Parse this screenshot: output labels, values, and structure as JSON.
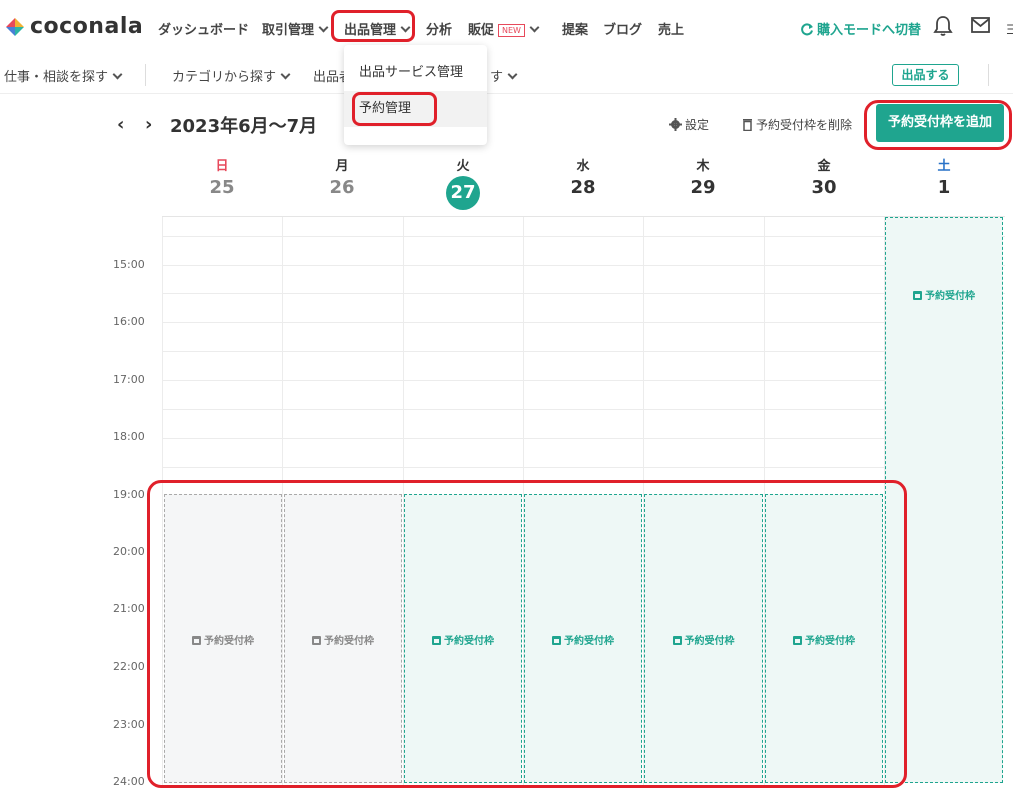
{
  "header": {
    "logo_text": "coconala",
    "nav": [
      {
        "label": "ダッシュボード"
      },
      {
        "label": "取引管理"
      },
      {
        "label": "出品管理"
      },
      {
        "label": "分析"
      },
      {
        "label": "販促",
        "badge": "NEW"
      },
      {
        "label": "提案"
      },
      {
        "label": "ブログ"
      },
      {
        "label": "売上"
      }
    ],
    "mode_switch": "購入モードへ切替",
    "more": "ヨ"
  },
  "subnav": {
    "items": [
      "仕事・相談を探す",
      "カテゴリから探す",
      "出品者",
      "す"
    ],
    "post_button": "出品する"
  },
  "dropdown": {
    "items": [
      "出品サービス管理",
      "予約管理"
    ]
  },
  "calendar": {
    "title": "2023年6月〜7月",
    "prev": "‹",
    "next": "›",
    "settings": "設定",
    "delete_slots": "予約受付枠を削除",
    "add_slot": "予約受付枠を追加",
    "days": [
      {
        "dow": "日",
        "num": "25"
      },
      {
        "dow": "月",
        "num": "26"
      },
      {
        "dow": "火",
        "num": "27"
      },
      {
        "dow": "水",
        "num": "28"
      },
      {
        "dow": "木",
        "num": "29"
      },
      {
        "dow": "金",
        "num": "30"
      },
      {
        "dow": "土",
        "num": "1"
      }
    ],
    "times": [
      "15:00",
      "16:00",
      "17:00",
      "18:00",
      "19:00",
      "20:00",
      "21:00",
      "22:00",
      "23:00",
      "24:00"
    ],
    "slot_label": "予約受付枠"
  },
  "colors": {
    "accent": "#1fa58f",
    "highlight": "#e0202a",
    "sunday": "#e7495b",
    "saturday": "#2a73c8"
  }
}
